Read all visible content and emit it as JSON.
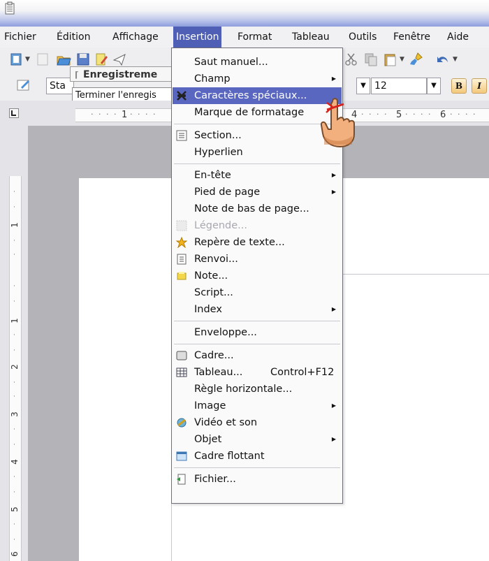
{
  "menubar": {
    "items": [
      "Fichier",
      "Édition",
      "Affichage",
      "Insertion",
      "Format",
      "Tableau",
      "Outils",
      "Fenêtre",
      "Aide"
    ],
    "active": "Insertion"
  },
  "toolbar": {
    "style_combo_value": "Sta",
    "font_size_value": "12",
    "bold_label": "B",
    "italic_label": "I",
    "tooltip_title": "Enregistreme",
    "tooltip_action": "Terminer l'enregis"
  },
  "ruler": {
    "h_numbers": [
      "1",
      "4",
      "5",
      "6"
    ],
    "v_numbers": [
      "1",
      "1",
      "2",
      "3",
      "4",
      "5",
      "6"
    ]
  },
  "insert_menu": {
    "items": [
      {
        "label": "Saut manuel...",
        "icon": "",
        "arrow": false,
        "disabled": false
      },
      {
        "label": "Champ",
        "icon": "",
        "arrow": true,
        "disabled": false
      },
      {
        "label": "Caractères spéciaux...",
        "icon": "special-chars-icon",
        "arrow": false,
        "disabled": false,
        "highlighted": true
      },
      {
        "label": "Marque de formatage",
        "icon": "",
        "arrow": false,
        "disabled": false
      },
      {
        "sep": true
      },
      {
        "label": "Section...",
        "icon": "section-icon",
        "arrow": false,
        "disabled": false
      },
      {
        "label": "Hyperlien",
        "icon": "",
        "arrow": false,
        "disabled": false
      },
      {
        "sep": true
      },
      {
        "label": "En-tête",
        "icon": "",
        "arrow": true,
        "disabled": false
      },
      {
        "label": "Pied de page",
        "icon": "",
        "arrow": true,
        "disabled": false
      },
      {
        "label": "Note de bas de page...",
        "icon": "",
        "arrow": false,
        "disabled": false
      },
      {
        "label": "Légende...",
        "icon": "caption-icon",
        "arrow": false,
        "disabled": true
      },
      {
        "label": "Repère de texte...",
        "icon": "bookmark-star-icon",
        "arrow": false,
        "disabled": false
      },
      {
        "label": "Renvoi...",
        "icon": "cross-reference-icon",
        "arrow": false,
        "disabled": false
      },
      {
        "label": "Note...",
        "icon": "note-icon",
        "arrow": false,
        "disabled": false
      },
      {
        "label": "Script...",
        "icon": "",
        "arrow": false,
        "disabled": false
      },
      {
        "label": "Index",
        "icon": "",
        "arrow": true,
        "disabled": false
      },
      {
        "sep": true
      },
      {
        "label": "Enveloppe...",
        "icon": "",
        "arrow": false,
        "disabled": false
      },
      {
        "sep": true
      },
      {
        "label": "Cadre...",
        "icon": "frame-icon",
        "arrow": false,
        "disabled": false
      },
      {
        "label": "Tableau...",
        "shortcut": "Control+F12",
        "icon": "table-icon",
        "arrow": false,
        "disabled": false
      },
      {
        "label": "Règle horizontale...",
        "icon": "",
        "arrow": false,
        "disabled": false
      },
      {
        "label": "Image",
        "icon": "",
        "arrow": true,
        "disabled": false
      },
      {
        "label": "Vidéo et son",
        "icon": "video-sound-icon",
        "arrow": false,
        "disabled": false
      },
      {
        "label": "Objet",
        "icon": "",
        "arrow": true,
        "disabled": false
      },
      {
        "label": "Cadre flottant",
        "icon": "floating-frame-icon",
        "arrow": false,
        "disabled": false
      },
      {
        "sep": true
      },
      {
        "label": "Fichier...",
        "icon": "file-insert-icon",
        "arrow": false,
        "disabled": false
      }
    ]
  },
  "colors": {
    "menu_highlight": "#5a67c0",
    "menubar_active": "#4e5fb5"
  }
}
